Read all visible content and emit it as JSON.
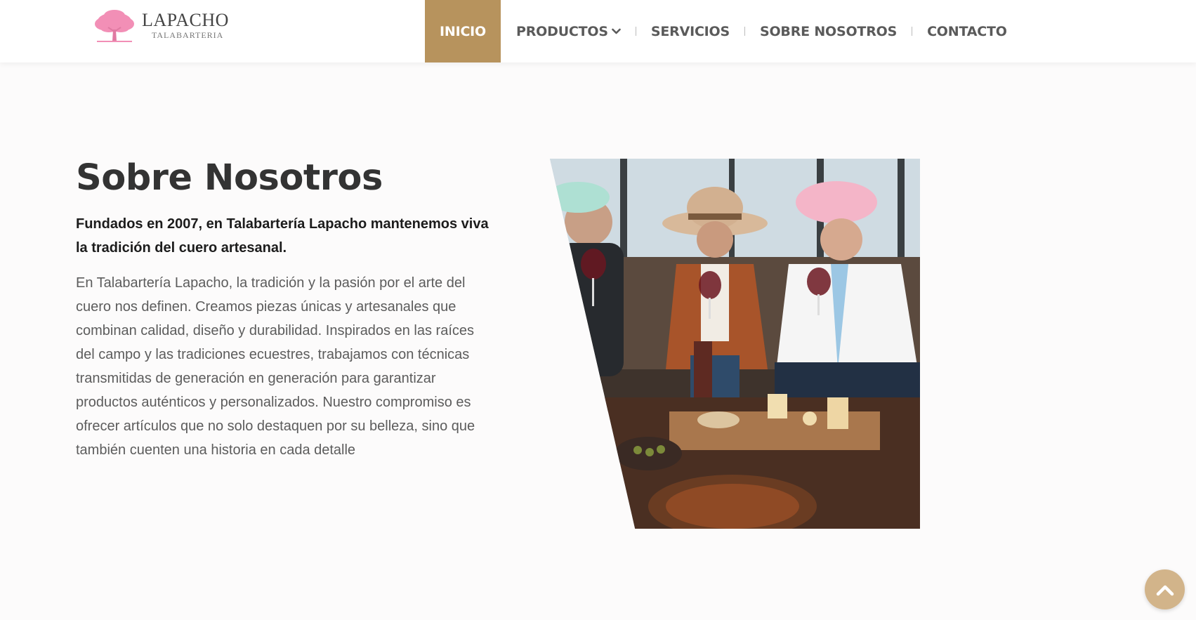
{
  "brand": {
    "name": "LAPACHO",
    "subtitle": "TALABARTERIA",
    "logo_icon": "pink-tree-icon",
    "logo_color": "#f28fb6"
  },
  "nav": {
    "items": [
      {
        "label": "INICIO",
        "active": true
      },
      {
        "label": "PRODUCTOS",
        "has_dropdown": true
      },
      {
        "label": "SERVICIOS"
      },
      {
        "label": "SOBRE NOSOTROS"
      },
      {
        "label": "CONTACTO"
      }
    ],
    "active_color": "#b7935d"
  },
  "about": {
    "title": "Sobre Nosotros",
    "lead": "Fundados en 2007, en Talabartería Lapacho mantenemos viva la tradición del cuero artesanal.",
    "body": "En Talabartería Lapacho, la tradición y la pasión por el arte del cuero nos definen. Creamos piezas únicas y artesanales que combinan calidad, diseño y durabilidad. Inspirados en las raíces del campo y las tradiciones ecuestres, trabajamos con técnicas transmitidas de generación en generación para garantizar productos auténticos y personalizados. Nuestro compromiso es ofrecer artículos que no solo destaquen por su belleza, sino que también cuenten una historia en cada detalle"
  },
  "scroll_top": {
    "icon": "chevron-up-icon",
    "color": "#d2b48a"
  }
}
